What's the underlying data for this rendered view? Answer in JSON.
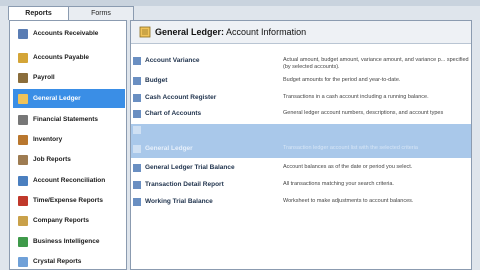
{
  "tabs": [
    {
      "label": "Reports",
      "active": true
    },
    {
      "label": "Forms",
      "active": false
    }
  ],
  "sidebar": {
    "items": [
      {
        "label": "Accounts Receivable",
        "icon": "ar-icon",
        "color": "#5a7db4"
      },
      {
        "label": "Accounts Payable",
        "icon": "ap-icon",
        "color": "#d4a537"
      },
      {
        "label": "Payroll",
        "icon": "payroll-icon",
        "color": "#8a6d3b"
      },
      {
        "label": "General Ledger",
        "icon": "general-ledger-icon",
        "color": "#f0c35a",
        "selected": true
      },
      {
        "label": "Financial Statements",
        "icon": "financial-statements-icon",
        "color": "#777777"
      },
      {
        "label": "Inventory",
        "icon": "inventory-icon",
        "color": "#b9772e"
      },
      {
        "label": "Job Reports",
        "icon": "job-reports-icon",
        "color": "#9e7c52"
      },
      {
        "label": "Account Reconciliation",
        "icon": "reconciliation-icon",
        "color": "#4b7fbf"
      },
      {
        "label": "Time/Expense Reports",
        "icon": "time-expense-icon",
        "color": "#c0392b"
      },
      {
        "label": "Company Reports",
        "icon": "company-reports-icon",
        "color": "#c9a14a"
      },
      {
        "label": "Business Intelligence",
        "icon": "business-intelligence-icon",
        "color": "#3f9a4a"
      },
      {
        "label": "Crystal Reports",
        "icon": "crystal-reports-icon",
        "color": "#6fa0d8"
      }
    ]
  },
  "header": {
    "title_bold": "General Ledger:",
    "title_rest": " Account Information"
  },
  "reports": [
    {
      "name": "Account Variance",
      "desc": "Actual amount, budget amount, variance amount, and variance p... specified (by selected accounts)."
    },
    {
      "name": "Budget",
      "desc": "Budget amounts for the period and year-to-date."
    },
    {
      "name": "Cash Account Register",
      "desc": "Transactions in a cash account including a running balance."
    },
    {
      "name": "Chart of Accounts",
      "desc": "General ledger account numbers, descriptions, and account types"
    },
    {
      "name": "",
      "desc": "",
      "highlight": true
    },
    {
      "name": "General Ledger",
      "desc": "Transaction ledger account list with the selected criteria",
      "highlight": true
    },
    {
      "name": "General Ledger Trial Balance",
      "desc": "Account balances as of the date or period you select."
    },
    {
      "name": "Transaction Detail Report",
      "desc": "All transactions matching your search criteria."
    },
    {
      "name": "Working Trial Balance",
      "desc": "Worksheet to make adjustments to account balances."
    }
  ]
}
